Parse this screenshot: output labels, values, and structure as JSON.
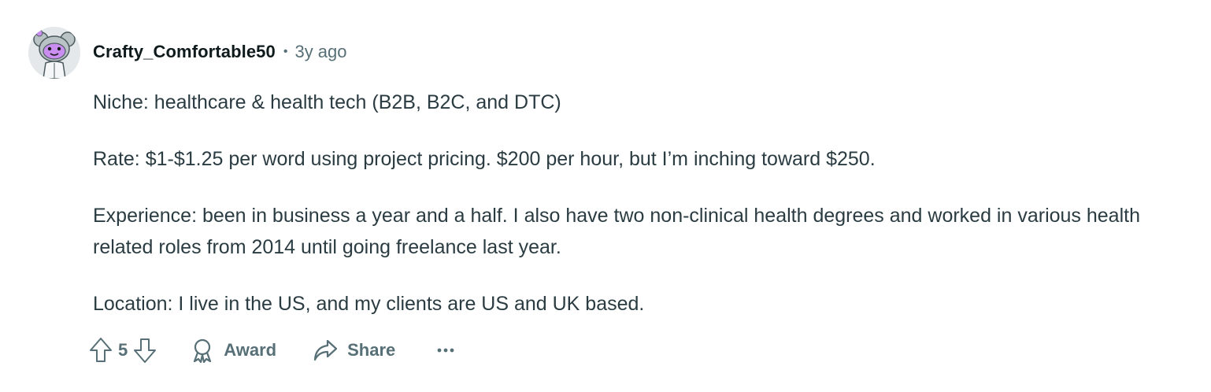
{
  "comment": {
    "username": "Crafty_Comfortable50",
    "separator": "•",
    "timestamp": "3y ago",
    "paragraphs": [
      "Niche: healthcare & health tech (B2B, B2C, and DTC)",
      "Rate: $1-$1.25 per word using project pricing. $200 per hour, but I’m inching toward $250.",
      "Experience: been in business a year and a half. I also have two non-clinical health degrees and worked in various health related roles from 2014 until going freelance last year.",
      "Location: I live in the US, and my clients are US and UK based."
    ],
    "avatar_icon": "snoo-avatar-icon"
  },
  "actions": {
    "score": "5",
    "award_label": "Award",
    "share_label": "Share",
    "upvote_icon": "upvote-arrow-icon",
    "downvote_icon": "downvote-arrow-icon",
    "award_icon": "award-ribbon-icon",
    "share_icon": "share-arrow-icon",
    "more_icon": "more-dots-icon"
  },
  "colors": {
    "username": "#0f1a1c",
    "body_text": "#2a3c42",
    "meta_text": "#576f76",
    "avatar_bg": "#e4e8ea",
    "avatar_accent": "#c98ef0"
  }
}
